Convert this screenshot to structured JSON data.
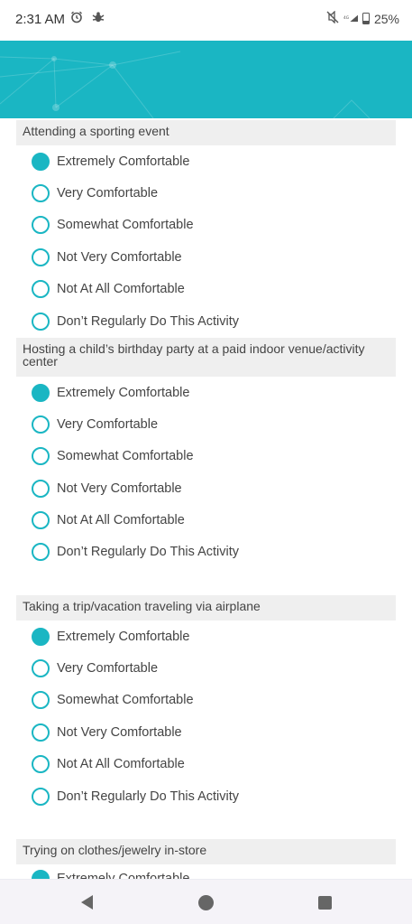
{
  "status_bar": {
    "time": "2:31 AM",
    "left_icons": [
      "alarm-clock-icon",
      "bug-icon"
    ],
    "right_icons": [
      "mute-icon",
      "lte-signal-icon",
      "battery-icon"
    ],
    "battery": "25%"
  },
  "colors": {
    "accent": "#1ab6c3",
    "question_bg": "#efefef"
  },
  "questions": [
    {
      "text": "Attending a sporting event",
      "selected_index": 0,
      "options": [
        "Extremely Comfortable",
        "Very Comfortable",
        "Somewhat Comfortable",
        "Not Very Comfortable",
        "Not At All Comfortable",
        "Don’t Regularly Do This Activity"
      ]
    },
    {
      "text": "Hosting a child’s birthday party at a paid indoor venue/activity center",
      "selected_index": 0,
      "options": [
        "Extremely Comfortable",
        "Very Comfortable",
        "Somewhat Comfortable",
        "Not Very Comfortable",
        "Not At All Comfortable",
        "Don’t Regularly Do This Activity"
      ]
    },
    {
      "text": "Taking a trip/vacation traveling via airplane",
      "selected_index": 0,
      "options": [
        "Extremely Comfortable",
        "Very Comfortable",
        "Somewhat Comfortable",
        "Not Very Comfortable",
        "Not At All Comfortable",
        "Don’t Regularly Do This Activity"
      ]
    },
    {
      "text": "Trying on clothes/jewelry in-store",
      "selected_index": 0,
      "options": [
        "Extremely Comfortable"
      ]
    }
  ],
  "nav_bar": {
    "icons": [
      "back-icon",
      "home-icon",
      "recents-icon"
    ]
  }
}
